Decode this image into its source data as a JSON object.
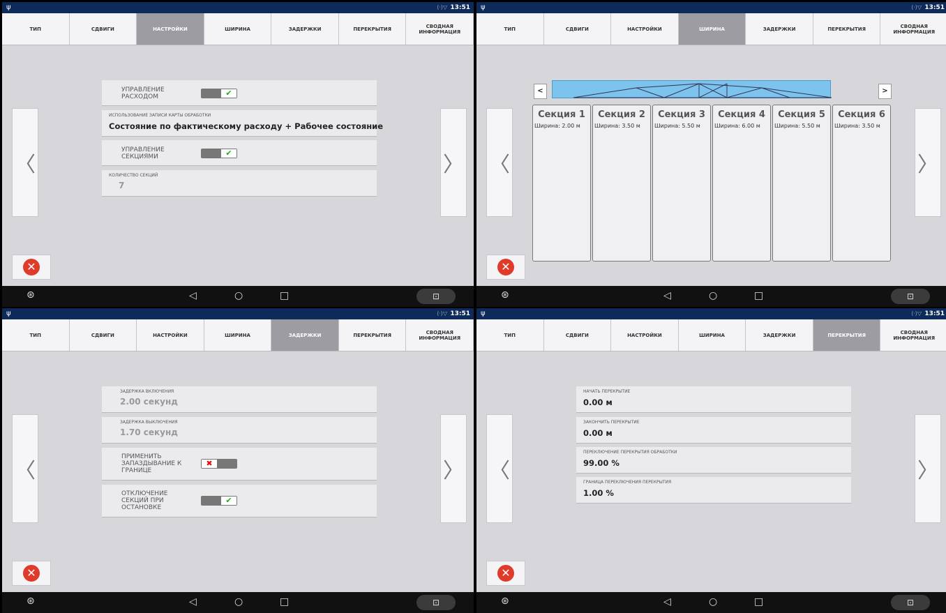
{
  "status_time": "13:51",
  "status_signal": "⟨·⟩▽",
  "tabs": [
    "ТИП",
    "СДВИГИ",
    "НАСТРОЙКИ",
    "ШИРИНА",
    "ЗАДЕРЖКИ",
    "ПЕРЕКРЫТИЯ",
    "СВОДНАЯ ИНФОРМАЦИЯ"
  ],
  "nav": {
    "prev": "〈",
    "next": "〉",
    "close": "✕"
  },
  "android": {
    "back": "◁",
    "home": "○",
    "recent": "□",
    "camera": "⊡",
    "logo": "⊛"
  },
  "panel1": {
    "rate_label": "УПРАВЛЕНИЕ РАСХОДОМ",
    "usage_small": "ИСПОЛЬЗОВАНИЕ ЗАПИСИ КАРТЫ ОБРАБОТКИ",
    "usage_value": "Состояние по фактическому расходу + Рабочее состояние",
    "section_label": "УПРАВЛЕНИЕ СЕКЦИЯМИ",
    "count_small": "КОЛИЧЕСТВО СЕКЦИЙ",
    "count_value": "7"
  },
  "panel2": {
    "left_arrow": "<",
    "right_arrow": ">",
    "sections": [
      {
        "name": "Секция 1",
        "width": "Ширина: 2.00 м"
      },
      {
        "name": "Секция 2",
        "width": "Ширина: 3.50 м"
      },
      {
        "name": "Секция 3",
        "width": "Ширина: 5.50 м"
      },
      {
        "name": "Секция 4",
        "width": "Ширина: 6.00 м"
      },
      {
        "name": "Секция 5",
        "width": "Ширина: 5.50 м"
      },
      {
        "name": "Секция 6",
        "width": "Ширина: 3.50 м"
      }
    ]
  },
  "panel3": {
    "on_small": "ЗАДЕРЖКА ВКЛЮЧЕНИЯ",
    "on_value": "2.00 секунд",
    "off_small": "ЗАДЕРЖКА ВЫКЛЮЧЕНИЯ",
    "off_value": "1.70 секунд",
    "boundary_label": "ПРИМЕНИТЬ ЗАПАЗДЫВАНИЕ К ГРАНИЦЕ",
    "stop_label": "ОТКЛЮЧЕНИЕ СЕКЦИЙ ПРИ ОСТАНОВКЕ"
  },
  "panel4": {
    "start_small": "НАЧАТЬ ПЕРЕКРЫТИЕ",
    "start_value": "0.00 м",
    "end_small": "ЗАКОНЧИТЬ ПЕРЕКРЫТИЕ",
    "end_value": "0.00 м",
    "switch_small": "ПЕРЕКЛЮЧЕНИЕ ПЕРЕКРЫТИЯ ОБРАБОТКИ",
    "switch_value": "99.00 %",
    "boundary_small": "ГРАНИЦА ПЕРЕКЛЮЧЕНИЯ ПЕРЕКРЫТИЯ",
    "boundary_value": "1.00 %"
  }
}
